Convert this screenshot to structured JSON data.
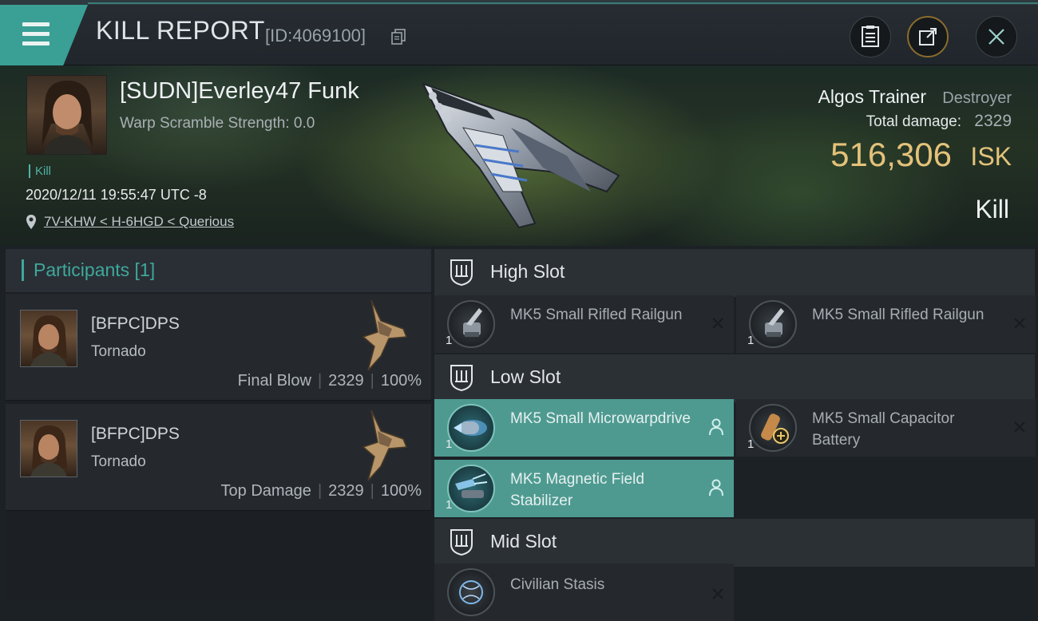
{
  "header": {
    "title": "KILL REPORT",
    "report_id": "[ID:4069100]"
  },
  "victim": {
    "name": "[SUDN]Everley47 Funk",
    "scramble": "Warp Scramble Strength: 0.0",
    "tag": "Kill",
    "datetime": "2020/12/11 19:55:47 UTC -8",
    "location": "7V-KHW < H-6HGD < Querious",
    "ship_name": "Algos Trainer",
    "ship_class": "Destroyer",
    "damage_label": "Total damage:",
    "damage_value": "2329",
    "isk_value": "516,306",
    "isk_unit": "ISK",
    "result": "Kill"
  },
  "participants": {
    "title": "Participants [1]",
    "rows": [
      {
        "name": "[BFPC]DPS",
        "ship": "Tornado",
        "role": "Final Blow",
        "damage": "2329",
        "percent": "100%"
      },
      {
        "name": "[BFPC]DPS",
        "ship": "Tornado",
        "role": "Top Damage",
        "damage": "2329",
        "percent": "100%"
      }
    ]
  },
  "fitting": {
    "high_slot": "High Slot",
    "low_slot": "Low Slot",
    "mid_slot": "Mid Slot",
    "high": [
      {
        "qty": "1",
        "name": "MK5 Small Rifled Railgun"
      },
      {
        "qty": "1",
        "name": "MK5 Small Rifled Railgun"
      }
    ],
    "low": [
      {
        "qty": "1",
        "name": "MK5 Small Microwarpdrive"
      },
      {
        "qty": "1",
        "name": "MK5 Small Capacitor Battery"
      },
      {
        "qty": "1",
        "name": "MK5 Magnetic Field Stabilizer"
      }
    ],
    "mid": [
      {
        "qty": "",
        "name": "Civilian Stasis"
      }
    ]
  },
  "colors": {
    "accent": "#3ea89c",
    "isk_gold": "#e3c27a",
    "active_module": "#4e9a91"
  }
}
